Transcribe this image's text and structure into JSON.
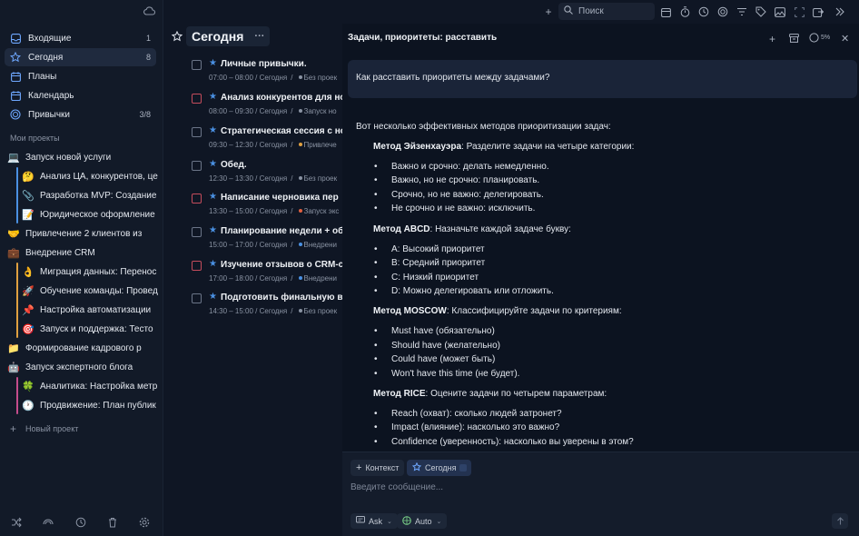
{
  "sidebar": {
    "nav": [
      {
        "label": "Входящие",
        "count": "1",
        "icon": "inbox-icon"
      },
      {
        "label": "Сегодня",
        "count": "8",
        "icon": "star-icon"
      },
      {
        "label": "Планы",
        "count": "",
        "icon": "calendar-icon"
      },
      {
        "label": "Календарь",
        "count": "",
        "icon": "calendar-icon"
      },
      {
        "label": "Привычки",
        "count": "3/8",
        "icon": "habit-icon"
      }
    ],
    "section_label": "Мои проекты",
    "projects": {
      "p1": {
        "emoji": "💻",
        "label": "Запуск новой услуги"
      },
      "p1s1": {
        "emoji": "🤔",
        "label": "Анализ ЦА, конкурентов, це"
      },
      "p1s2": {
        "emoji": "📎",
        "label": "Разработка MVP: Создание"
      },
      "p1s3": {
        "emoji": "📝",
        "label": "Юридическое оформление"
      },
      "p2": {
        "emoji": "🤝",
        "label": "Привлечение 2 клиентов из"
      },
      "p3": {
        "emoji": "💼",
        "label": "Внедрение CRM"
      },
      "p3s1": {
        "emoji": "👌",
        "label": "Миграция данных: Перенос"
      },
      "p3s2": {
        "emoji": "🚀",
        "label": "Обучение команды: Провед"
      },
      "p3s3": {
        "emoji": "📌",
        "label": "Настройка автоматизации"
      },
      "p3s4": {
        "emoji": "🎯",
        "label": "Запуск и поддержка: Тесто"
      },
      "p4": {
        "emoji": "📁",
        "label": "Формирование кадрового р"
      },
      "p5": {
        "emoji": "🤖",
        "label": "Запуск экспертного блога"
      },
      "p5s1": {
        "emoji": "🍀",
        "label": "Аналитика: Настройка метр"
      },
      "p5s2": {
        "emoji": "🕐",
        "label": "Продвижение: План публик"
      }
    },
    "new_project": "Новый проект"
  },
  "tasks": {
    "title": "Сегодня",
    "more": "···",
    "items": [
      {
        "title": "Личные привычки.",
        "time": "07:00 – 08:00 / Сегодня",
        "tag": "Без проек",
        "red": false,
        "dot": "#8a93a3"
      },
      {
        "title": "Анализ конкурентов для ново",
        "time": "08:00 – 09:30 / Сегодня",
        "tag": "Запуск но",
        "red": true,
        "dot": "#8a93a3"
      },
      {
        "title": "Стратегическая сессия с нов",
        "time": "09:30 – 12:30 / Сегодня",
        "tag": "Привлече",
        "red": false,
        "dot": "#e0a040"
      },
      {
        "title": "Обед.",
        "time": "12:30 – 13:30 / Сегодня",
        "tag": "Без проек",
        "red": false,
        "dot": "#8a93a3"
      },
      {
        "title": "Написание черновика пер",
        "time": "13:30 – 15:00 / Сегодня",
        "tag": "Запуск экс",
        "red": true,
        "dot": "#e06040"
      },
      {
        "title": "Планирование недели + обн",
        "time": "15:00 – 17:00 / Сегодня",
        "tag": "Внедрени",
        "red": false,
        "dot": "#4a90e2"
      },
      {
        "title": "Изучение отзывов о CRM-сис",
        "time": "17:00 – 18:00 / Сегодня",
        "tag": "Внедрени",
        "red": true,
        "dot": "#4a90e2"
      },
      {
        "title": "Подготовить финальную веро",
        "time": "14:30 – 15:00 / Сегодня",
        "tag": "Без проек",
        "red": false,
        "dot": "#8a93a3"
      }
    ]
  },
  "toolbar": {
    "search_placeholder": "Поиск"
  },
  "chat": {
    "title": "Задачи, приоритеты: расставить",
    "progress": "5%",
    "user_message": "Как расставить приоритеты между задачами?",
    "intro": "Вот несколько эффективных методов приоритизации задач:",
    "methods": {
      "eisenhower": {
        "name": "Метод Эйзенхауэра",
        "desc": ": Разделите задачи на четыре категории:",
        "items": [
          "Важно и срочно: делать немедленно.",
          "Важно, но не срочно: планировать.",
          "Срочно, но не важно: делегировать.",
          "Не срочно и не важно: исключить."
        ]
      },
      "abcd": {
        "name": "Метод ABCD",
        "desc": ": Назначьте каждой задаче букву:",
        "items": [
          "A: Высокий приоритет",
          "B: Средний приоритет",
          "C: Низкий приоритет",
          "D: Можно делегировать или отложить."
        ]
      },
      "moscow": {
        "name": "Метод MOSCOW",
        "desc": ": Классифицируйте задачи по критериям:",
        "items": [
          "Must have (обязательно)",
          "Should have (желательно)",
          "Could have (может быть)",
          "Won't have this time (не будет)."
        ]
      },
      "rice": {
        "name": "Метод RICE",
        "desc": ": Оцените задачи по четырем параметрам:",
        "items": [
          "Reach (охват): сколько людей затронет?",
          "Impact (влияние): насколько это важно?",
          "Confidence (уверенность): насколько вы уверены в этом?"
        ]
      }
    },
    "composer": {
      "chip_context": "Контекст",
      "chip_today": "Сегодня",
      "placeholder": "Введите сообщение...",
      "mode": "Ask",
      "model": "Auto"
    }
  }
}
